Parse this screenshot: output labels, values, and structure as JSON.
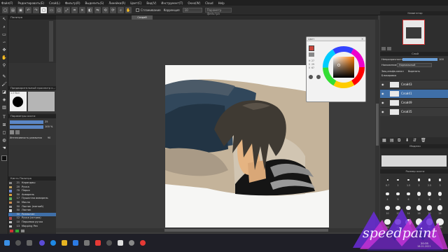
{
  "menubar": {
    "items": [
      "Файл(F)",
      "Редактировать(E)",
      "Слой(L)",
      "Фильтр(R)",
      "Выделить(S)",
      "Линейка(R)",
      "Цвет(C)",
      "Вид(V)",
      "Инструмент(T)",
      "Окно(W)",
      "Cloud",
      "Help"
    ]
  },
  "toolbar": {
    "antialias_label": "Сглаживание",
    "correction_label": "Коррекция",
    "correction_value": "10",
    "filter_placeholder": "Параметр фильтра"
  },
  "document": {
    "tab_label": "Cоздай"
  },
  "left_panel": {
    "palette_title": "Палитра",
    "brush_preview_title": "Предварительный просмотр к...",
    "brush_preview_size": "1.0 бол",
    "brush_params_title": "Параметры кисти",
    "brush_size_value": "25",
    "brush_opacity_value": "100 %",
    "blur_intensity_label": "Интенсивность размытия",
    "blur_intensity_value": "90",
    "brush_list_title": "Кисть  Палитра",
    "brushes": [
      {
        "size": "21",
        "name": "Карандаш",
        "color": "#888888"
      },
      {
        "size": "20",
        "name": "Ручка",
        "color": "#bfa060"
      },
      {
        "size": "70",
        "name": "Перья",
        "color": "#6d8bd6"
      },
      {
        "size": "50",
        "name": "Акварель",
        "color": "#d99a3c"
      },
      {
        "size": "17",
        "name": "Пушистая акварель",
        "color": "#5fb05c"
      },
      {
        "size": "30",
        "name": "Масло",
        "color": "#c98a50"
      },
      {
        "size": "50",
        "name": "Ластик (мягкий)",
        "color": "#9a9a9a"
      },
      {
        "size": "50",
        "name": "Ластик",
        "color": "#dddddd"
      },
      {
        "size": "50",
        "name": "Размытие",
        "color": "#3a78c2"
      },
      {
        "size": "12",
        "name": "Ручка (острая)",
        "color": "#b04a4a"
      },
      {
        "size": "10",
        "name": "Перьевая ручка",
        "color": "#c0c0c0"
      },
      {
        "size": "13",
        "name": "Mapping Pen",
        "color": "#c0c0c0"
      }
    ],
    "selected_brush_index": 8
  },
  "color_window": {
    "title": "Цвет",
    "h_label": "H",
    "s_label": "S",
    "v_label": "V",
    "h_value": "27",
    "s_value": "29",
    "v_value": "67"
  },
  "right_panel": {
    "navigator_title": "Навигатор",
    "layer_title": "Слой",
    "opacity_label": "Непрозрачность",
    "opacity_value": "100",
    "blend_label": "Наложение",
    "blend_value": "Нормальный",
    "protect_alpha_label": "Защ.альфа-канал",
    "crop_label": "Вырезать",
    "mask_label": "Блокировка",
    "layers": [
      "Слой43",
      "Слой41",
      "Слой49",
      "Слой35"
    ],
    "selected_layer": 1,
    "material_title": "Модели",
    "brush_size_title": "Размер кисти",
    "brush_sizes": [
      "0.7",
      "1",
      "1.5",
      "2",
      "2.5",
      "3",
      "4",
      "5",
      "6",
      "7",
      "8",
      "9",
      "10",
      "12",
      "14",
      "16",
      "20",
      "25",
      "30",
      "40",
      "50",
      "60",
      "80",
      "100"
    ]
  },
  "taskbar": {
    "time": "20:35",
    "date": "18.01.2021",
    "watermark": "speedpaint"
  },
  "colors": {
    "accent": "#3f6fa8",
    "menubar": "#202020",
    "panel": "#333333",
    "canvas_bg": "#3c3c3c"
  }
}
